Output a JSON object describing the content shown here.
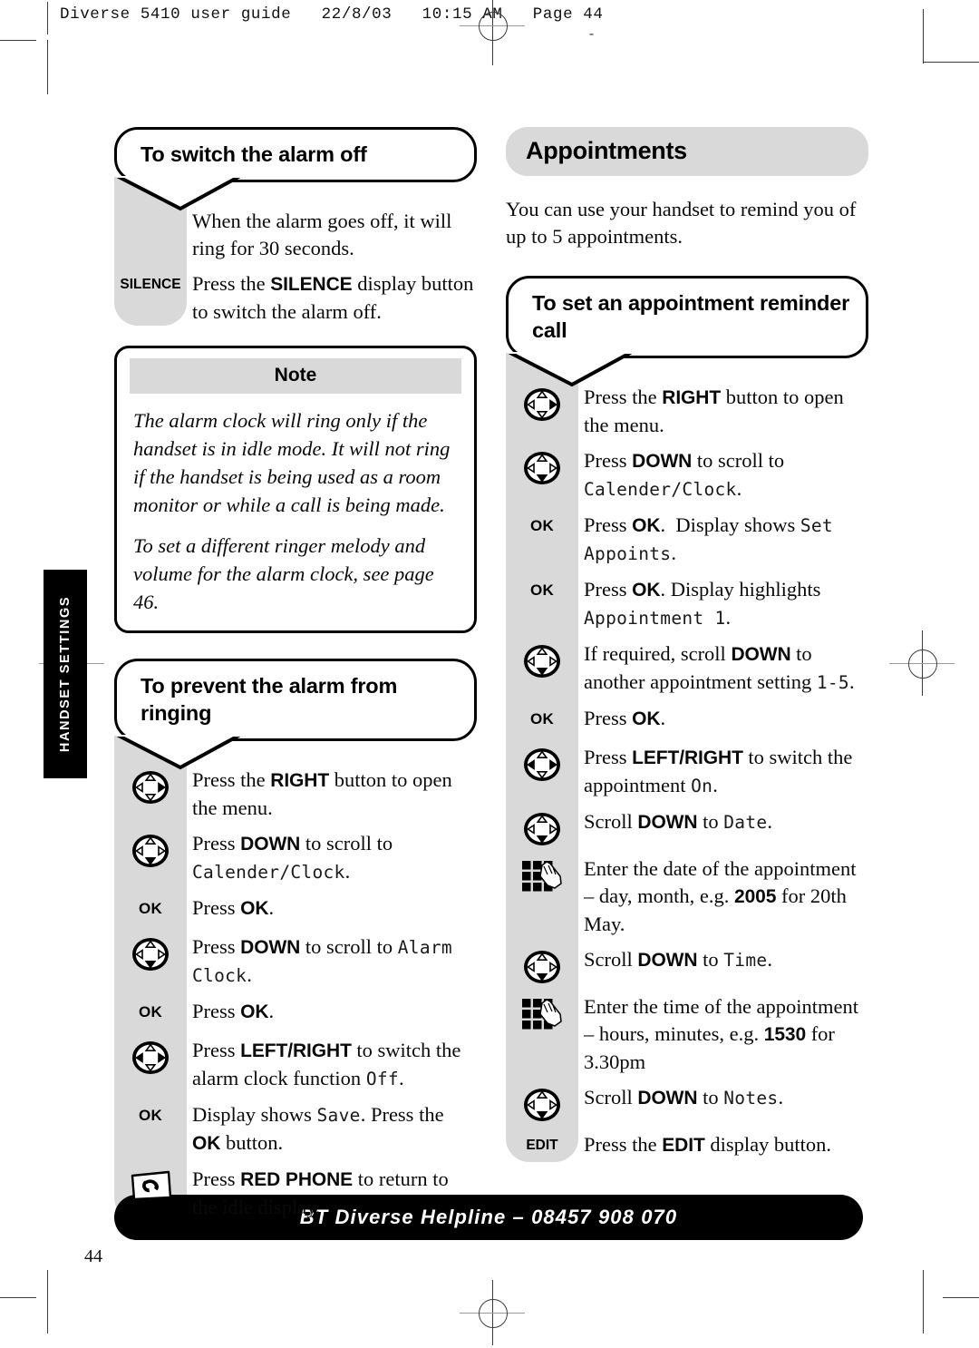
{
  "prepress": {
    "header": "Diverse 5410 user guide   22/8/03   10:15 AM   Page 44",
    "tiny_mark": "-"
  },
  "side_tab": {
    "label": "HANDSET SETTINGS"
  },
  "page": {
    "folio": "44"
  },
  "footer": {
    "helpline": "BT Diverse Helpline – 08457 908 070"
  },
  "left_column": {
    "section1": {
      "heading": "To switch the alarm off",
      "steps": [
        {
          "icon": "none",
          "icon_label": "",
          "text_html": "When the alarm goes off, it will ring for 30 seconds."
        },
        {
          "icon": "label",
          "icon_label": "SILENCE",
          "text_html": "Press the <b>SILENCE</b> display button to switch the alarm off."
        }
      ]
    },
    "note": {
      "title": "Note",
      "paragraphs": [
        "The alarm clock will ring only if the handset is in idle mode. It will not ring if the handset is being used as a room monitor or while a call is being made.",
        "To set a different ringer melody and volume for the alarm clock, see page 46."
      ]
    },
    "section2": {
      "heading": "To prevent the alarm from ringing",
      "steps": [
        {
          "icon": "navpad-right",
          "icon_label": "",
          "text_html": "Press the <b>RIGHT</b> button to open the menu."
        },
        {
          "icon": "navpad-down",
          "icon_label": "",
          "text_html": "Press <b>DOWN</b> to scroll to <span class=\"lcd\">Calender/Clock</span>."
        },
        {
          "icon": "label",
          "icon_label": "OK",
          "text_html": "Press <b>OK</b>."
        },
        {
          "icon": "navpad-down",
          "icon_label": "",
          "text_html": "Press <b>DOWN</b> to scroll to <span class=\"lcd\">Alarm Clock</span>."
        },
        {
          "icon": "label",
          "icon_label": "OK",
          "text_html": "Press <b>OK</b>."
        },
        {
          "icon": "navpad-leftright",
          "icon_label": "",
          "text_html": "Press <b>LEFT/RIGHT</b> to switch the alarm clock function <span class=\"lcd\">Off</span>."
        },
        {
          "icon": "label",
          "icon_label": "OK",
          "text_html": "Display shows <span class=\"lcd\">Save</span>. Press the <b>OK</b> button."
        },
        {
          "icon": "red-phone",
          "icon_label": "",
          "text_html": "Press <b>RED PHONE</b> to return to the idle display."
        }
      ]
    }
  },
  "right_column": {
    "title": "Appointments",
    "intro": "You can use your handset to remind you of up to 5 appointments.",
    "section1": {
      "heading": "To set an appointment reminder call",
      "steps": [
        {
          "icon": "navpad-right",
          "icon_label": "",
          "text_html": "Press the <b>RIGHT</b> button to open the menu."
        },
        {
          "icon": "navpad-down",
          "icon_label": "",
          "text_html": "Press <b>DOWN</b> to scroll to <span class=\"lcd\">Calender/Clock</span>."
        },
        {
          "icon": "label",
          "icon_label": "OK",
          "text_html": "Press <b>OK</b>.&nbsp; Display shows <span class=\"lcd\">Set Appoints</span>."
        },
        {
          "icon": "label",
          "icon_label": "OK",
          "text_html": "Press <b>OK</b>. Display highlights <span class=\"lcd\">Appointment 1</span>."
        },
        {
          "icon": "navpad-down",
          "icon_label": "",
          "text_html": "If required, scroll <b>DOWN</b> to another appointment setting <span class=\"lcd\">1-5</span>."
        },
        {
          "icon": "label",
          "icon_label": "OK",
          "text_html": "Press <b>OK</b>."
        },
        {
          "icon": "navpad-leftright",
          "icon_label": "",
          "text_html": "Press <b>LEFT/RIGHT</b> to switch the appointment <span class=\"lcd\">On</span>."
        },
        {
          "icon": "navpad-down",
          "icon_label": "",
          "text_html": "Scroll <b>DOWN</b> to <span class=\"lcd\">Date</span>."
        },
        {
          "icon": "keypad",
          "icon_label": "",
          "text_html": "Enter the date of the appointment – day, month, e.g. <b>2005</b> for 20th May."
        },
        {
          "icon": "navpad-down",
          "icon_label": "",
          "text_html": "Scroll <b>DOWN</b> to <span class=\"lcd\">Time</span>."
        },
        {
          "icon": "keypad",
          "icon_label": "",
          "text_html": "Enter the time of the appointment – hours, minutes, e.g. <b>1530</b> for 3.30pm"
        },
        {
          "icon": "navpad-down",
          "icon_label": "",
          "text_html": "Scroll <b>DOWN</b> to <span class=\"lcd\">Notes</span>."
        },
        {
          "icon": "label",
          "icon_label": "EDIT",
          "text_html": "Press the <b>EDIT</b> display button."
        }
      ]
    }
  },
  "colors": {
    "rail_grey": "#d9d9d9",
    "ink": "#000000",
    "paper": "#ffffff"
  }
}
